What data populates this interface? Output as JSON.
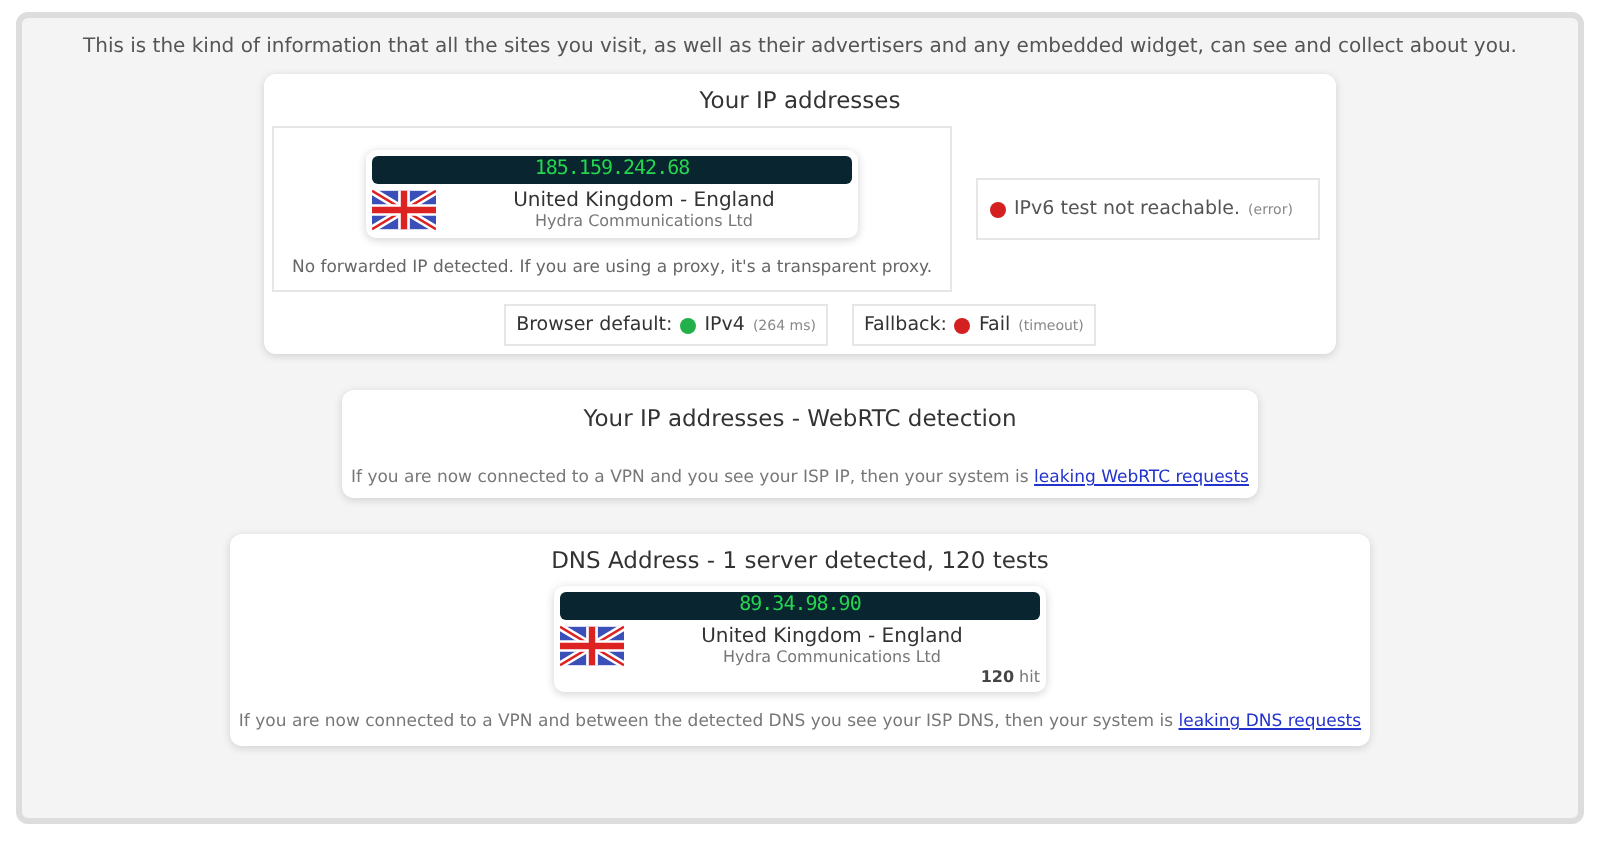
{
  "intro": "This is the kind of information that all the sites you visit, as well as their advertisers and any embedded widget, can see and collect about you.",
  "ip_card": {
    "title": "Your IP addresses",
    "ip": {
      "address": "185.159.242.68",
      "location": "United Kingdom - England",
      "isp": "Hydra Communications Ltd"
    },
    "note": "No forwarded IP detected. If you are using a proxy, it's a transparent proxy.",
    "ipv6": {
      "color": "#d42020",
      "text": "IPv6 test not reachable.",
      "detail": "(error)"
    },
    "tests": [
      {
        "label": "Browser default:",
        "color": "#22b04a",
        "value": "IPv4",
        "detail": "(264 ms)"
      },
      {
        "label": "Fallback:",
        "color": "#d42020",
        "value": "Fail",
        "detail": "(timeout)"
      }
    ]
  },
  "webrtc_card": {
    "title": "Your IP addresses - WebRTC detection",
    "note": "If you are now connected to a VPN and you see your ISP IP, then your system is",
    "link": "leaking WebRTC requests"
  },
  "dns_card": {
    "title": "DNS Address - 1 server detected, 120 tests",
    "server": {
      "address": "89.34.98.90",
      "location": "United Kingdom - England",
      "isp": "Hydra Communications Ltd",
      "hits": "120",
      "hits_label": "hit"
    },
    "note": "If you are now connected to a VPN and between the detected DNS you see your ISP DNS, then your system is",
    "link": "leaking DNS requests"
  }
}
